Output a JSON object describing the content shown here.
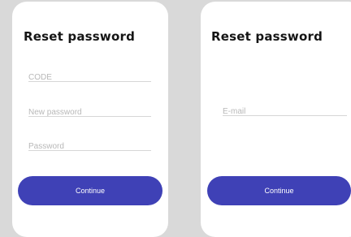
{
  "colors": {
    "background": "#d9d9d9",
    "card": "#ffffff",
    "accent": "#3f41b6",
    "title_text": "#151515",
    "placeholder": "#b8b8b8",
    "divider": "#d6d6d6"
  },
  "left_card": {
    "title": "Reset password",
    "fields": [
      {
        "value": "",
        "placeholder": "CODE"
      },
      {
        "value": "",
        "placeholder": "New password"
      },
      {
        "value": "",
        "placeholder": "Password"
      }
    ],
    "button_label": "Continue"
  },
  "right_card": {
    "title": "Reset password",
    "fields": [
      {
        "value": "",
        "placeholder": "E-mail"
      }
    ],
    "button_label": "Continue"
  }
}
